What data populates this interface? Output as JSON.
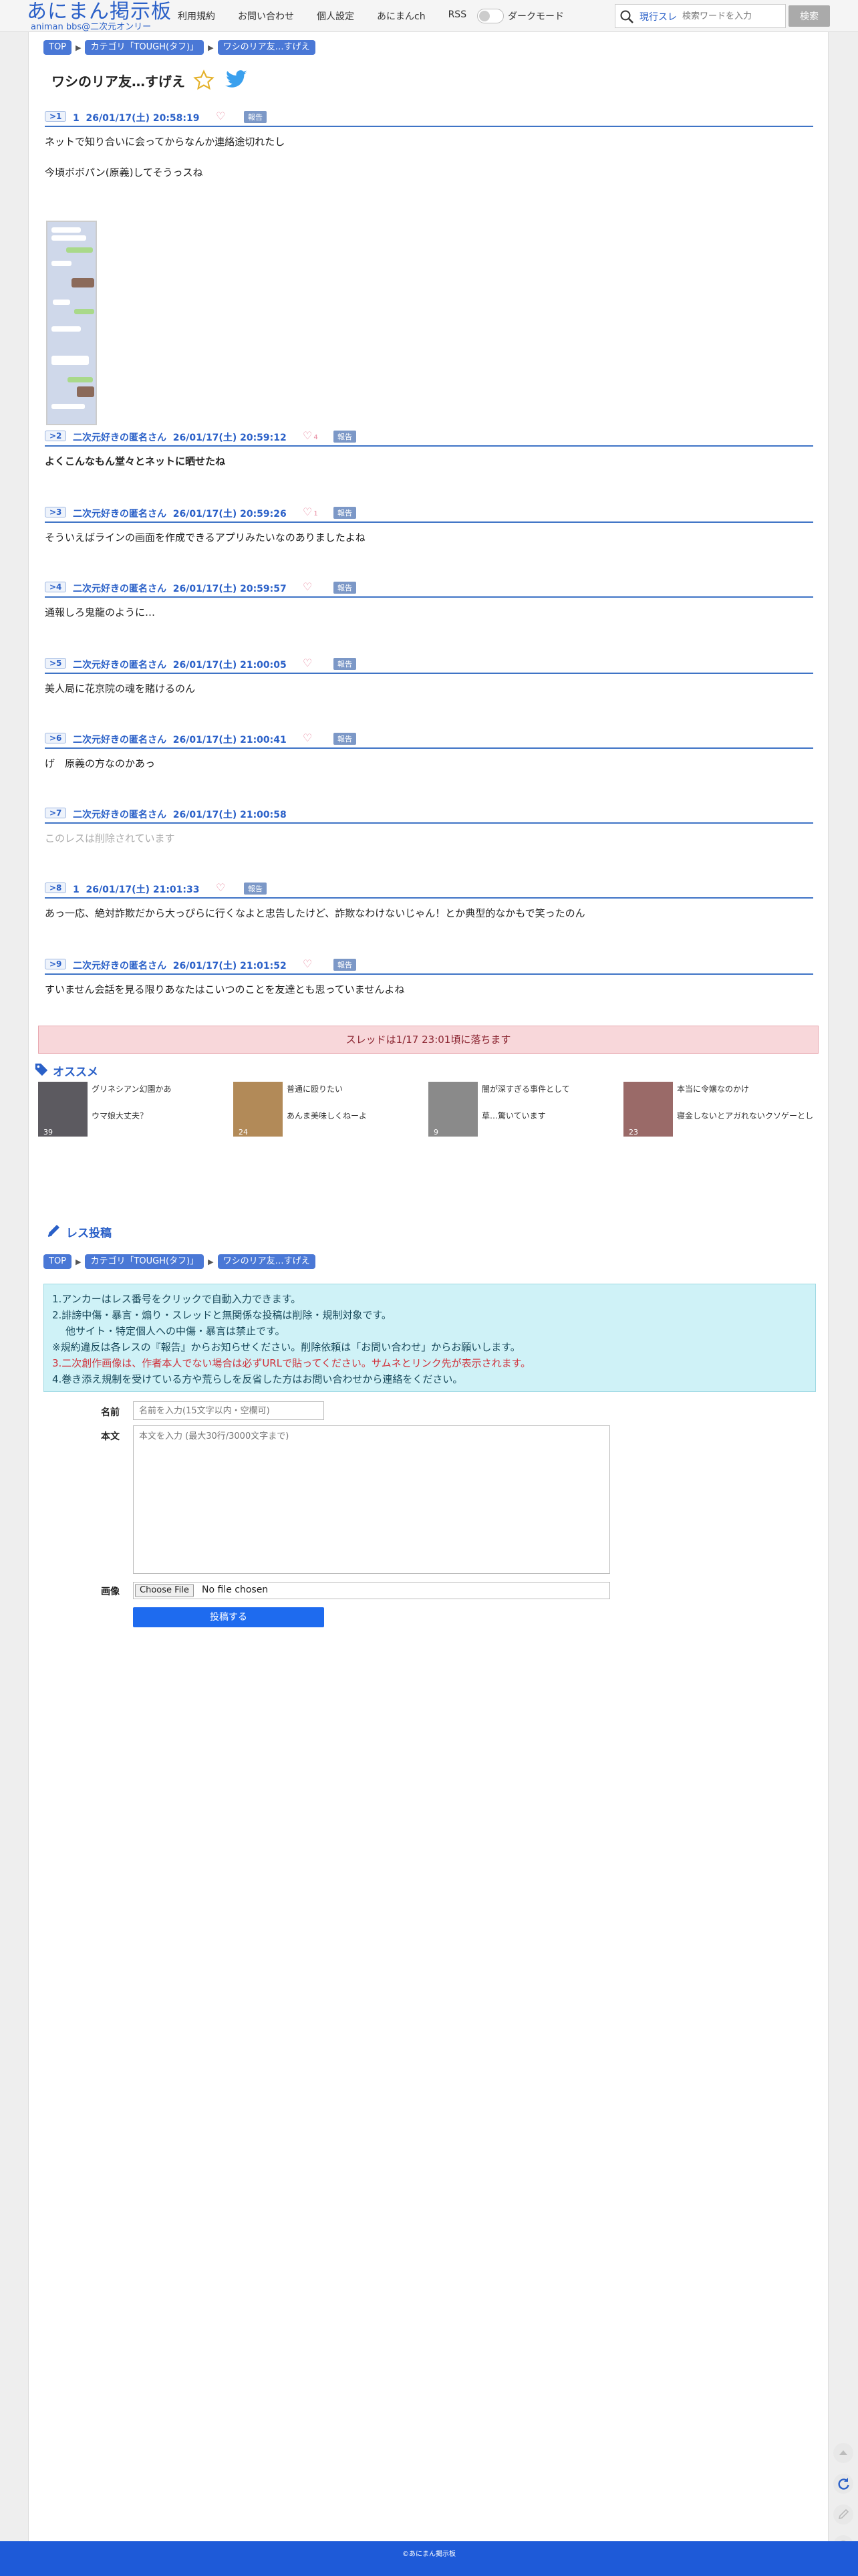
{
  "header": {
    "logo_main": "あにまん掲示板",
    "logo_sub": "animan bbs@二次元オンリー",
    "nav": [
      "利用規約",
      "お問い合わせ",
      "個人設定",
      "あにまんch",
      "RSS"
    ],
    "dark_mode_label": "ダークモード",
    "search_mode": "現行スレ",
    "search_placeholder": "検索ワードを入力",
    "search_button": "検索"
  },
  "breadcrumb": [
    "TOP",
    "カテゴリ「TOUGH(タフ)」",
    "ワシのリア友…すげえ"
  ],
  "thread_title": "ワシのリア友…すげえ",
  "report_label": "報告",
  "posts": [
    {
      "num": ">1",
      "name": "1",
      "date": "26/01/17(土) 20:58:19",
      "likes": "",
      "lines": [
        "ネットで知り合いに会ってからなんか連絡途切れたし",
        "今頃ボボパン(原義)してそうっスね"
      ]
    },
    {
      "num": ">2",
      "name": "二次元好きの匿名さん",
      "date": "26/01/17(土) 20:59:12",
      "likes": "4",
      "lines": [
        "よくこんなもん堂々とネットに晒せたね"
      ]
    },
    {
      "num": ">3",
      "name": "二次元好きの匿名さん",
      "date": "26/01/17(土) 20:59:26",
      "likes": "1",
      "lines": [
        "そういえばラインの画面を作成できるアプリみたいなのありましたよね"
      ]
    },
    {
      "num": ">4",
      "name": "二次元好きの匿名さん",
      "date": "26/01/17(土) 20:59:57",
      "likes": "",
      "lines": [
        "通報しろ鬼龍のように…"
      ]
    },
    {
      "num": ">5",
      "name": "二次元好きの匿名さん",
      "date": "26/01/17(土) 21:00:05",
      "likes": "",
      "lines": [
        "美人局に花京院の魂を賭けるのん"
      ]
    },
    {
      "num": ">6",
      "name": "二次元好きの匿名さん",
      "date": "26/01/17(土) 21:00:41",
      "likes": "",
      "lines": [
        "げ　原義の方なのかあっ"
      ]
    },
    {
      "num": ">7",
      "name": "二次元好きの匿名さん",
      "date": "26/01/17(土) 21:00:58",
      "likes": "",
      "lines": [
        "このレスは削除されています"
      ]
    },
    {
      "num": ">8",
      "name": "1",
      "date": "26/01/17(土) 21:01:33",
      "likes": "",
      "lines": [
        "あっ一応、絶対詐欺だから大っぴらに行くなよと忠告したけど、詐欺なわけないじゃん！とか典型的なかもで笑ったのん"
      ]
    },
    {
      "num": ">9",
      "name": "二次元好きの匿名さん",
      "date": "26/01/17(土) 21:01:52",
      "likes": "",
      "lines": [
        "すいません会話を見る限りあなたはこいつのことを友達とも思っていませんよね"
      ]
    }
  ],
  "notice": "スレッドは1/17 23:01頃に落ちます",
  "recommend": {
    "title": "オススメ",
    "items": [
      {
        "t1": "グリネシアン幻園かあ",
        "t2": "ウマ娘大丈夫？",
        "count": "39"
      },
      {
        "t1": "普通に殴りたい",
        "t2": "あんま美味しくねーよ",
        "count": "24"
      },
      {
        "t1": "闇が深すぎる事件として",
        "t2": "草…驚いています",
        "count": "9"
      },
      {
        "t1": "本当に令嬢なのかけ",
        "t2": "寝金しないとアガれないクソゲーとし",
        "count": "23"
      }
    ]
  },
  "reply": {
    "title": "レス投稿",
    "rules": [
      "1.アンカーはレス番号をクリックで自動入力できます。",
      "2.誹謗中傷・暴言・煽り・スレッドと無関係な投稿は削除・規制対象です。",
      "他サイト・特定個人への中傷・暴言は禁止です。",
      "※規約違反は各レスの『報告』からお知らせください。削除依頼は「お問い合わせ」からお願いします。",
      "3.二次創作画像は、作者本人でない場合は必ずURLで貼ってください。サムネとリンク先が表示されます。",
      "4.巻き添え規制を受けている方や荒らしを反省した方はお問い合わせから連絡をください。"
    ],
    "name_label": "名前",
    "name_placeholder": "名前を入力(15文字以内・空欄可)",
    "body_label": "本文",
    "body_placeholder": "本文を入力 (最大30行/3000文字まで)",
    "image_label": "画像",
    "choose_file": "Choose File",
    "no_file": "No file chosen",
    "submit": "投稿する"
  },
  "footer": "©あにまん掲示板"
}
